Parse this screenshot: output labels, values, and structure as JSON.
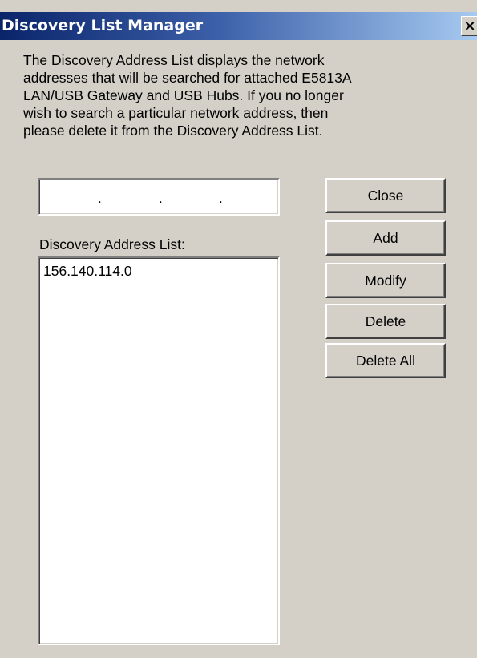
{
  "window": {
    "title": "Discovery List Manager",
    "close_glyph": "×"
  },
  "description": "The Discovery Address List displays the network\naddresses that will be searched for attached E5813A\nLAN/USB Gateway and USB Hubs. If you no longer\nwish to search a particular network address, then\nplease delete it from the Discovery Address List.",
  "ip_input": {
    "separators": [
      ".",
      ".",
      "."
    ]
  },
  "address_list": {
    "label": "Discovery Address List:",
    "items": [
      "156.140.114.0"
    ]
  },
  "buttons": {
    "close": "Close",
    "add": "Add",
    "modify": "Modify",
    "delete": "Delete",
    "delete_all": "Delete All"
  },
  "colors": {
    "window_face": "#d4d0c8",
    "titlebar_start": "#0a246a",
    "titlebar_end": "#a6caf0",
    "title_text": "#ffffff"
  }
}
